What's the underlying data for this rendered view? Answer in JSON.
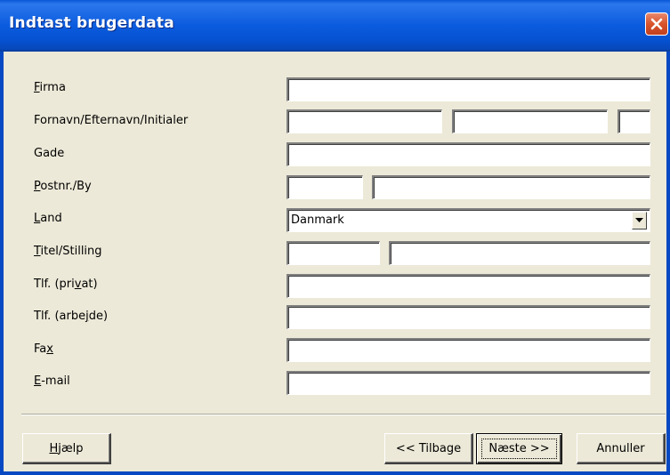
{
  "window": {
    "title": "Indtast brugerdata"
  },
  "form": {
    "firma_label": "Firma",
    "navn_label": "Fornavn/Efternavn/Initialer",
    "gade_label": "Gade",
    "postnr_label": "Postnr./By",
    "land_label": "Land",
    "land_value": "Danmark",
    "titel_label": "Titel/Stilling",
    "tlf_privat_label": "Tlf. (privat)",
    "tlf_arbejde_label": "Tlf. (arbejde)",
    "fax_label": "Fax",
    "email_label": "E-mail"
  },
  "buttons": {
    "help": "Hjælp",
    "back": "<< Tilbage",
    "next": "Næste >>",
    "cancel": "Annuller"
  },
  "colors": {
    "title_bar": "#0A58D8",
    "dialog_bg": "#ECE9D8",
    "close_button": "#D9532B"
  }
}
